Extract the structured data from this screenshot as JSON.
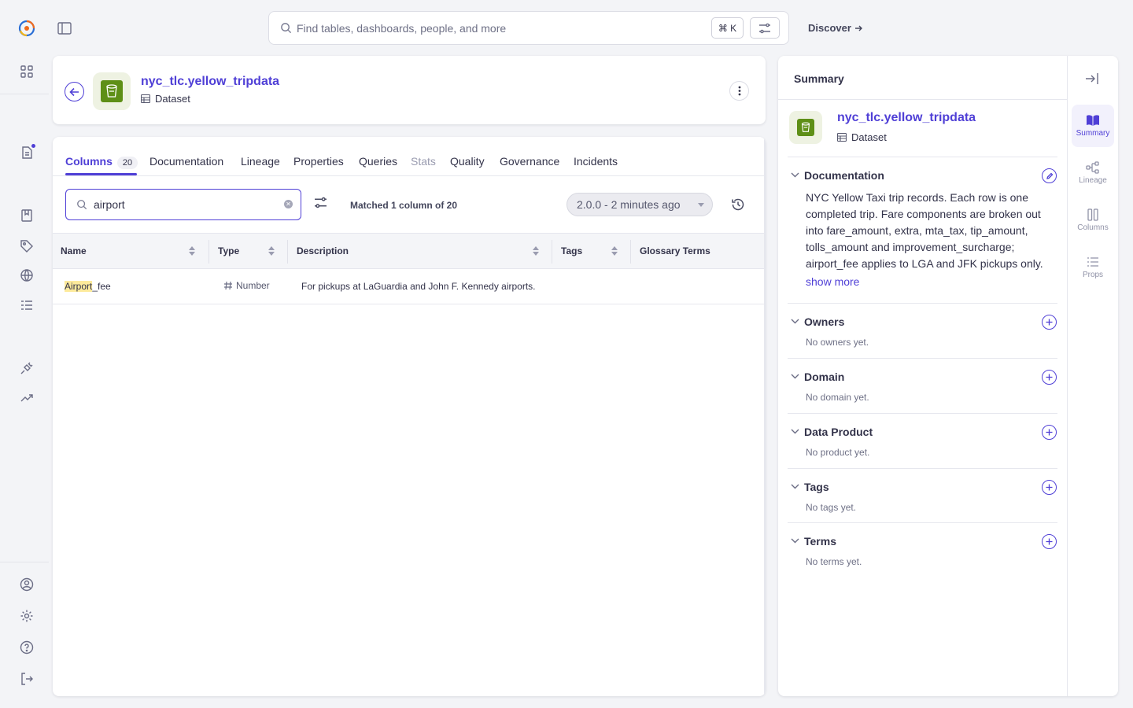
{
  "search": {
    "placeholder": "Find tables, dashboards, people, and more",
    "shortcut": "⌘ K"
  },
  "discover_label": "Discover",
  "dataset": {
    "name": "nyc_tlc.yellow_tripdata",
    "type": "Dataset"
  },
  "tabs": [
    {
      "label": "Columns",
      "count": "20"
    },
    {
      "label": "Documentation"
    },
    {
      "label": "Lineage"
    },
    {
      "label": "Properties"
    },
    {
      "label": "Queries"
    },
    {
      "label": "Stats"
    },
    {
      "label": "Quality"
    },
    {
      "label": "Governance"
    },
    {
      "label": "Incidents"
    }
  ],
  "column_filter": {
    "value": "airport",
    "matched_text": "Matched 1 column of 20"
  },
  "version": "2.0.0 - 2 minutes ago",
  "table": {
    "headers": [
      "Name",
      "Type",
      "Description",
      "Tags",
      "Glossary Terms"
    ],
    "rows": [
      {
        "name_highlight": "Airport",
        "name_rest": "_fee",
        "type": "Number",
        "description": "For pickups at LaGuardia and John F. Kennedy airports."
      }
    ]
  },
  "summary": {
    "title": "Summary",
    "name": "nyc_tlc.yellow_tripdata",
    "type": "Dataset",
    "documentation": {
      "title": "Documentation",
      "text": "NYC Yellow Taxi trip records. Each row is one completed trip. Fare components are broken out into fare_amount, extra, mta_tax, tip_amount, tolls_amount and improvement_surcharge; airport_fee applies to LGA and JFK pickups only.",
      "show_more": "show more"
    },
    "sections": [
      {
        "title": "Owners",
        "empty": "No owners yet."
      },
      {
        "title": "Domain",
        "empty": "No domain yet."
      },
      {
        "title": "Data Product",
        "empty": "No product yet."
      },
      {
        "title": "Tags",
        "empty": "No tags yet."
      },
      {
        "title": "Terms",
        "empty": "No terms yet."
      }
    ]
  },
  "side_tabs": [
    "Summary",
    "Lineage",
    "Columns",
    "Props"
  ],
  "colors": {
    "accent": "#4f3fd6",
    "dataset_logo": "#5e8f17",
    "highlight": "#fdea9c"
  }
}
